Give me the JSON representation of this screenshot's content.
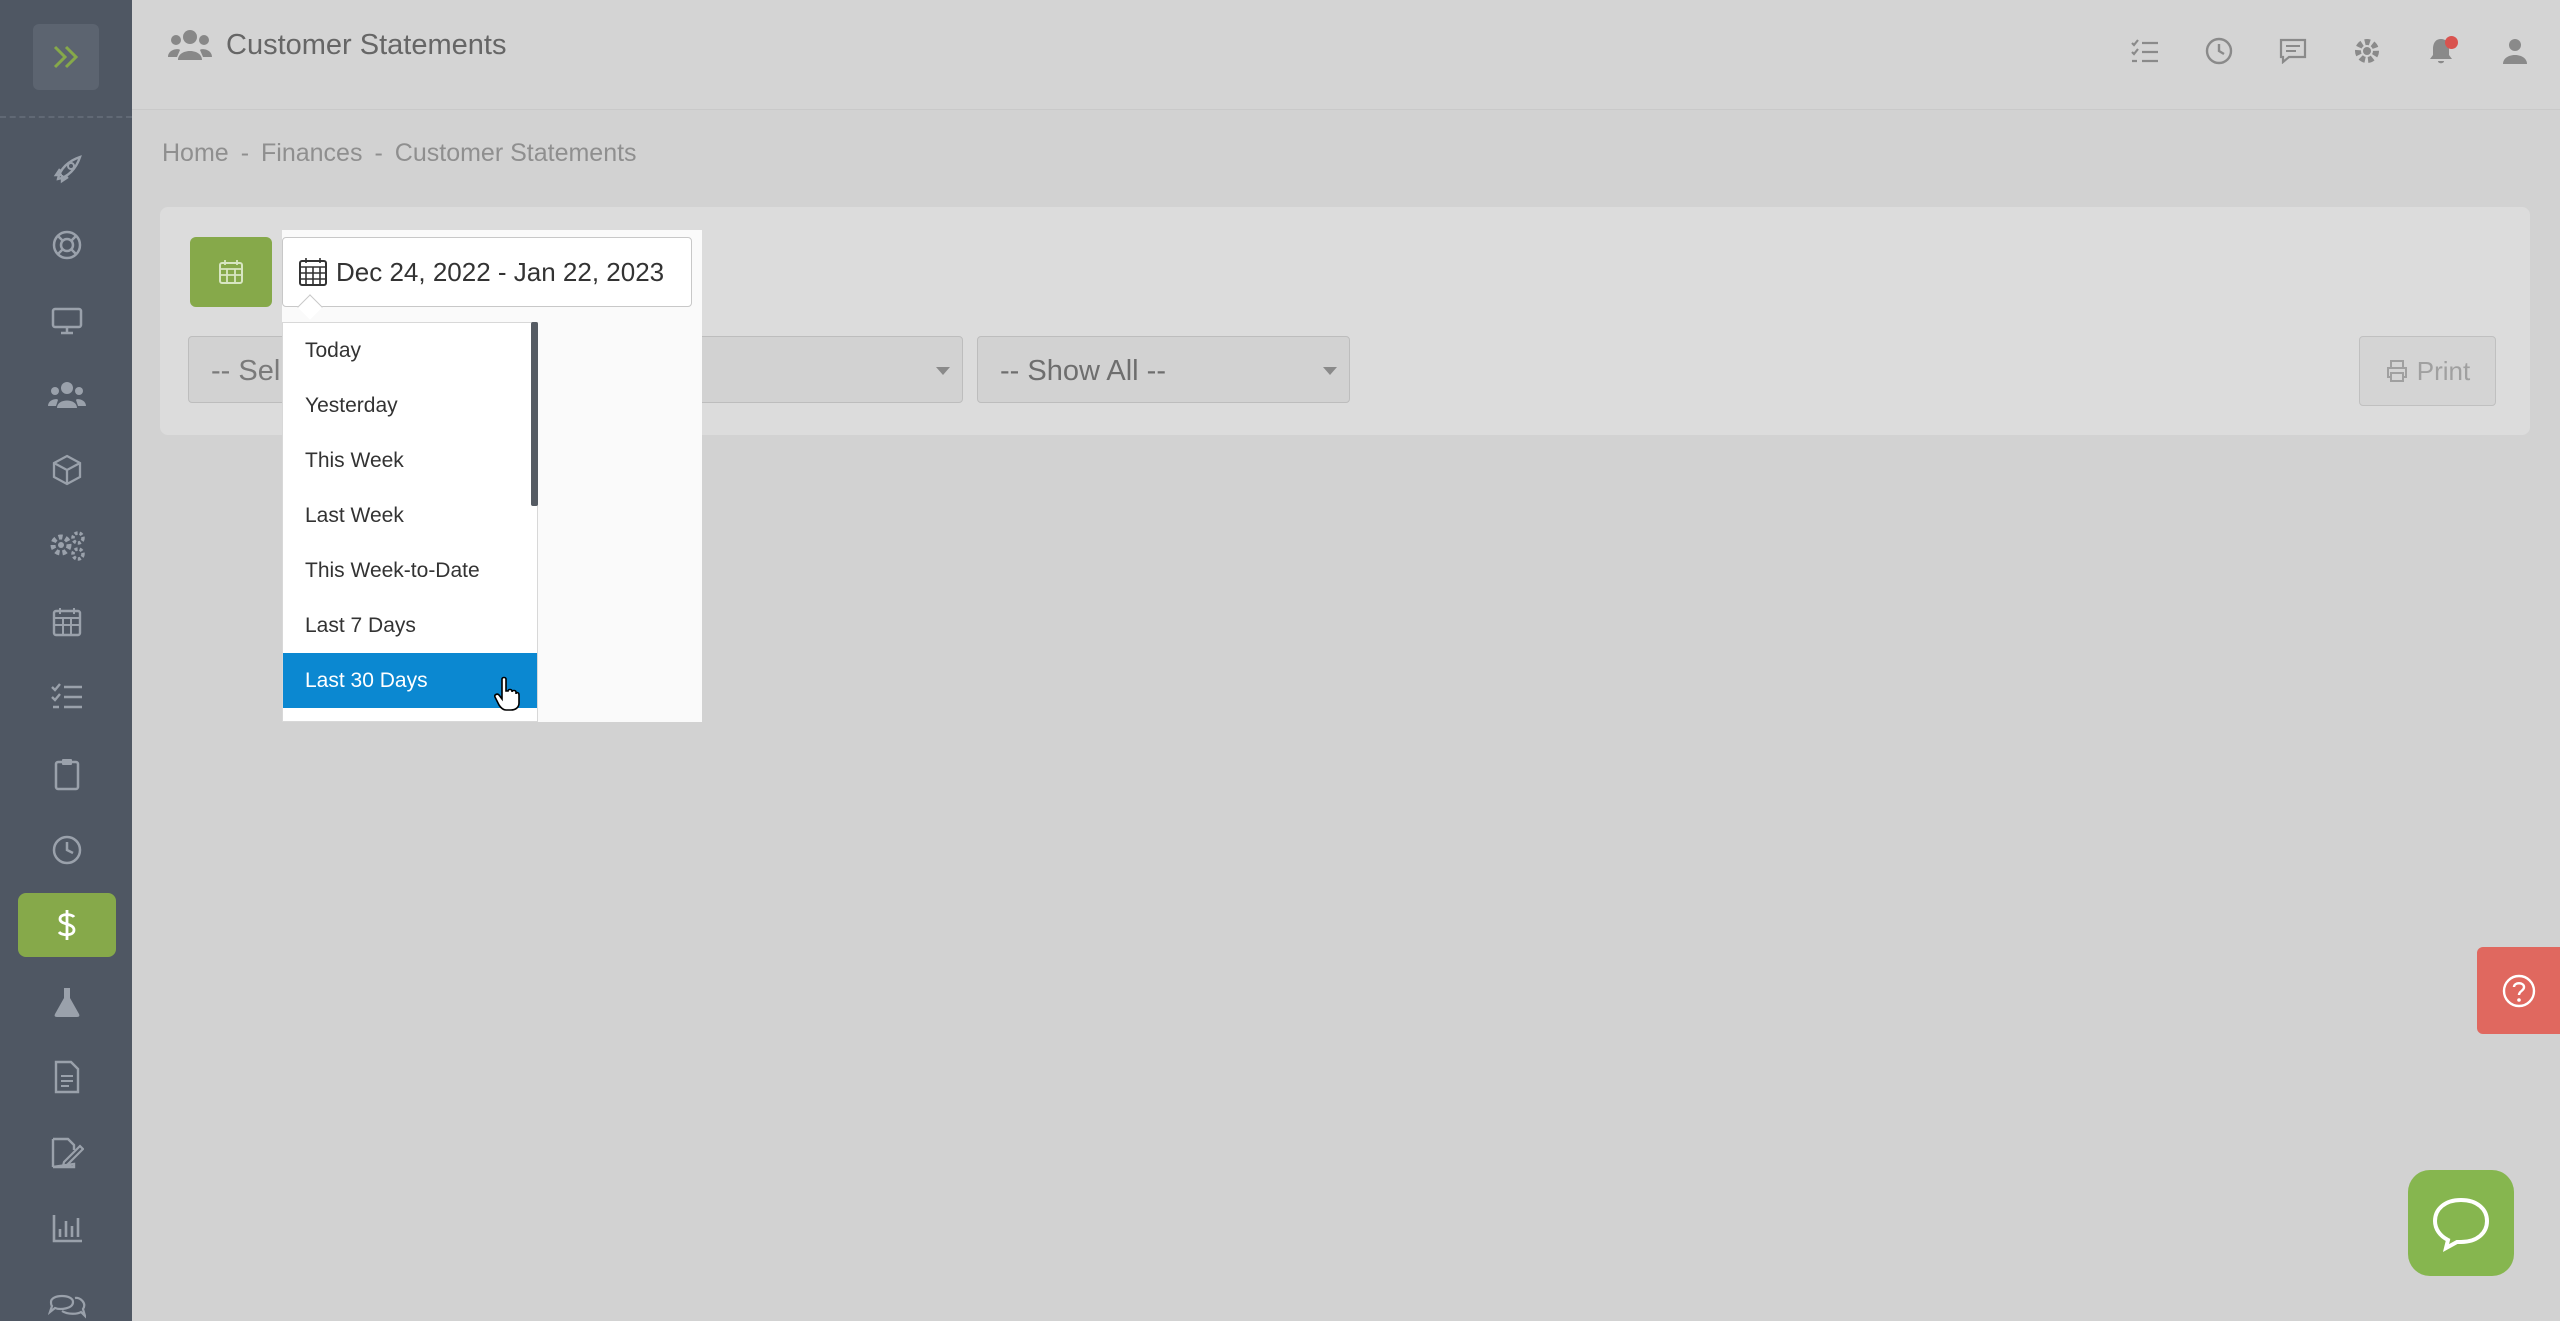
{
  "header": {
    "title": "Customer Statements",
    "icons": [
      "tasks-icon",
      "history-icon",
      "messages-icon",
      "settings-icon",
      "notifications-icon",
      "user-icon"
    ]
  },
  "breadcrumb": {
    "home": "Home",
    "sep1": "-",
    "finances": "Finances",
    "sep2": "-",
    "current": "Customer Statements"
  },
  "sidebar": {
    "items": [
      "rocket-icon",
      "lifebuoy-icon",
      "monitor-icon",
      "users-icon",
      "box-icon",
      "cogs-icon",
      "calendar-icon",
      "checklist-icon",
      "clipboard-icon",
      "clock-icon",
      "dollar-icon",
      "flask-icon",
      "document-icon",
      "signature-icon",
      "chart-icon",
      "chat-icon"
    ],
    "active": "dollar-icon"
  },
  "filters": {
    "date_range": "Dec 24, 2022 - Jan 22, 2023",
    "customer_select": "-- Sel",
    "show_select": "-- Show All --",
    "print_label": "Print"
  },
  "ranges": {
    "items": [
      "Today",
      "Yesterday",
      "This Week",
      "Last Week",
      "This Week-to-Date",
      "Last 7 Days",
      "Last 30 Days"
    ],
    "selected": "Last 30 Days",
    "selected_color": "#0b88d1"
  },
  "colors": {
    "sidebar": "#4f5763",
    "accent_green": "#86a94a",
    "help_red": "#e0685f"
  }
}
